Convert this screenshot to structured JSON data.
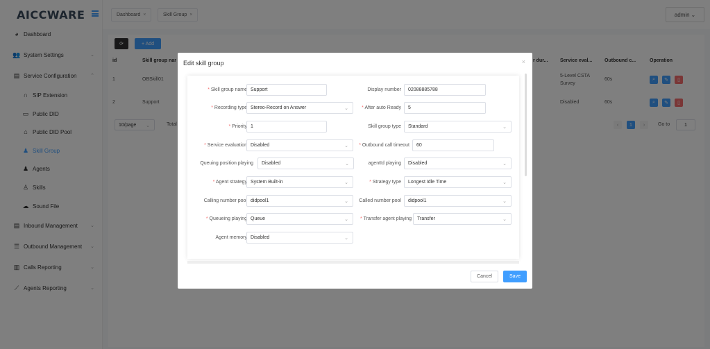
{
  "app": {
    "logo": "AICCWARE"
  },
  "sidebar": {
    "items": [
      {
        "label": "Dashboard",
        "icon": "dashboard-icon"
      },
      {
        "label": "System Settings",
        "icon": "users-icon"
      },
      {
        "label": "Service Configuration",
        "icon": "service-icon"
      },
      {
        "label": "SIP Extension",
        "icon": "headset-icon"
      },
      {
        "label": "Public DID",
        "icon": "folder-icon"
      },
      {
        "label": "Public DID Pool",
        "icon": "home-icon"
      },
      {
        "label": "Skill Group",
        "icon": "person-icon"
      },
      {
        "label": "Agents",
        "icon": "person-icon"
      },
      {
        "label": "Skills",
        "icon": "person-outline-icon"
      },
      {
        "label": "Sound File",
        "icon": "cloud-icon"
      },
      {
        "label": "Inbound Management",
        "icon": "inbound-icon"
      },
      {
        "label": "Outbound Management",
        "icon": "list-icon"
      },
      {
        "label": "Calls Reporting",
        "icon": "bar-chart-icon"
      },
      {
        "label": "Agents Reporting",
        "icon": "line-chart-icon"
      }
    ]
  },
  "header": {
    "tabs": [
      {
        "label": "Dashboard"
      },
      {
        "label": "Skill Group"
      }
    ],
    "user": "admin"
  },
  "toolbar": {
    "add_label": "+ Add"
  },
  "table": {
    "columns": [
      "id",
      "Skill group nar",
      "r dur...",
      "Service eval...",
      "Outbound c...",
      "Operation"
    ],
    "rows": [
      {
        "id": "1",
        "name": "OBSkill01",
        "service": "5-Level CSTA Survey",
        "outbound": "60s"
      },
      {
        "id": "2",
        "name": "Support",
        "service": "Disabled",
        "outbound": "60s"
      }
    ]
  },
  "pagination": {
    "page_size": "10/page",
    "total": "Total",
    "current": "1",
    "goto_label": "Go to",
    "goto_value": "1"
  },
  "modal": {
    "title": "Edit skill group",
    "fields": {
      "skill_group_name": {
        "label": "Skill group name",
        "value": "Support"
      },
      "display_number": {
        "label": "Display number",
        "value": "02088885788"
      },
      "recording_type": {
        "label": "Recording type",
        "value": "Stereo-Record on Answer"
      },
      "after_auto_ready": {
        "label": "After auto Ready",
        "value": "5"
      },
      "priority": {
        "label": "Priority",
        "value": "1"
      },
      "skill_group_type": {
        "label": "Skill group type",
        "value": "Standard"
      },
      "service_evaluation": {
        "label": "Service evaluation",
        "value": "Disabled"
      },
      "outbound_call_timeout": {
        "label": "Outbound call timeout",
        "value": "60"
      },
      "queuing_position_playing": {
        "label": "Queuing position playing",
        "value": "Disabled"
      },
      "agentid_playing": {
        "label": "agentId playing",
        "value": "Disabled"
      },
      "agent_strategy": {
        "label": "Agent strategy",
        "value": "System Built-in"
      },
      "strategy_type": {
        "label": "Strategy type",
        "value": "Longest Idle Time"
      },
      "calling_number_pool": {
        "label": "Calling number pool",
        "value": "didpool1"
      },
      "called_number_pool": {
        "label": "Called number pool",
        "value": "didpool1"
      },
      "queueing_playing": {
        "label": "Queueing playing",
        "value": "Queue"
      },
      "transfer_agent_playing": {
        "label": "Transfer agent playing",
        "value": "Transfer"
      },
      "agent_memory": {
        "label": "Agent memory",
        "value": "Disabled"
      }
    },
    "cancel_label": "Cancel",
    "save_label": "Save"
  },
  "colors": {
    "primary": "#409eff",
    "danger": "#f56c6c",
    "dark": "#303133"
  }
}
